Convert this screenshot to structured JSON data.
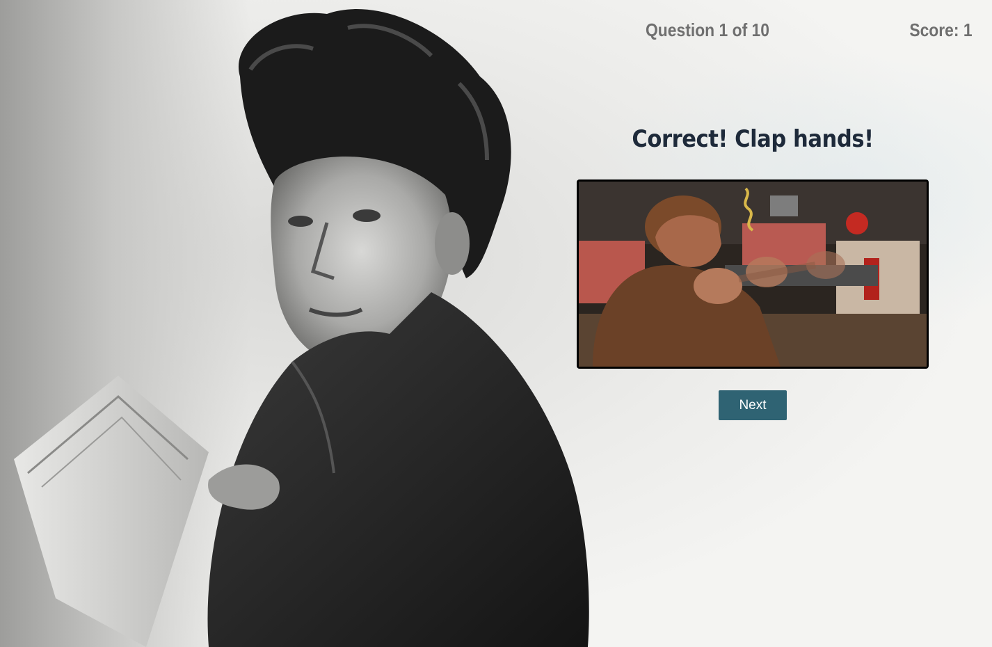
{
  "header": {
    "question_counter": "Question 1 of 10",
    "score": "Score: 1"
  },
  "feedback": {
    "title": "Correct! Clap hands!"
  },
  "actions": {
    "next_label": "Next"
  },
  "colors": {
    "background": "#f3f3f1",
    "header_text": "#6f6f6f",
    "title_text": "#1e2a3a",
    "button_bg": "#2f6373",
    "button_text": "#ffffff"
  },
  "icons": {
    "background_image": "portrait-photo",
    "result_media": "clapping-gif"
  }
}
